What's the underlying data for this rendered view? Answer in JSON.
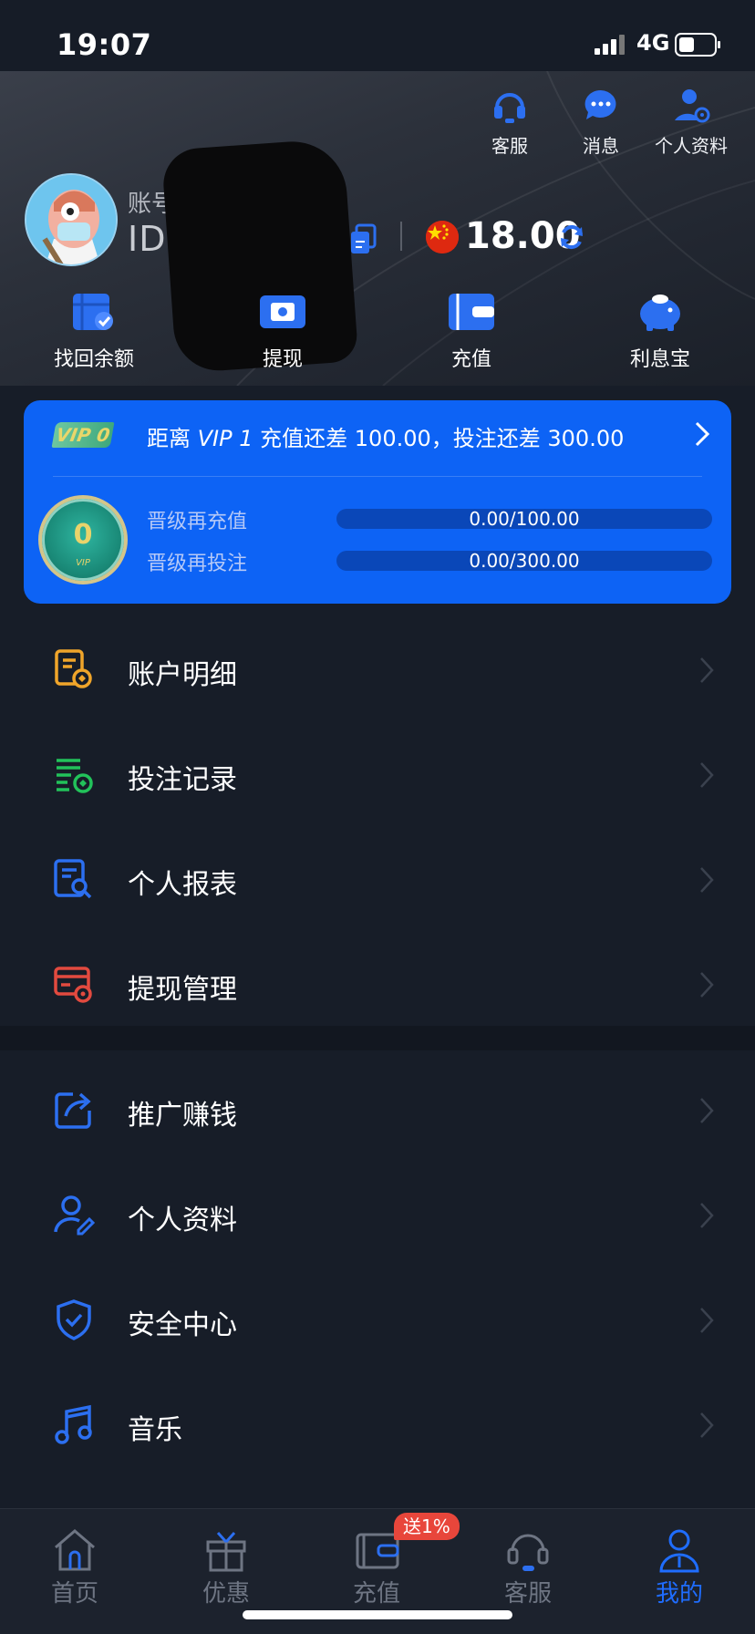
{
  "status_bar": {
    "time": "19:07",
    "network": "4G"
  },
  "header": {
    "top_links": [
      {
        "label": "客服",
        "icon": "headset-icon"
      },
      {
        "label": "消息",
        "icon": "chat-bubble-icon"
      },
      {
        "label": "个人资料",
        "icon": "user-settings-icon"
      }
    ],
    "account_label": "账号",
    "account_id_prefix": "ID",
    "balance": "18.00",
    "currency_flag": "cn-flag-icon",
    "quick_actions": [
      {
        "label": "找回余额",
        "icon": "recover-balance-icon"
      },
      {
        "label": "提现",
        "icon": "withdraw-icon"
      },
      {
        "label": "充值",
        "icon": "wallet-icon"
      },
      {
        "label": "利息宝",
        "icon": "piggy-bank-icon"
      }
    ]
  },
  "vip": {
    "badge": "VIP 0",
    "message_prefix": "距离",
    "message_level": "VIP 1",
    "message_suffix": "充值还差 100.00，投注还差 300.00",
    "medal_level": "0",
    "medal_text": "VIP",
    "rows": [
      {
        "label": "晋级再充值",
        "progress_text": "0.00/100.00",
        "progress": 0
      },
      {
        "label": "晋级再投注",
        "progress_text": "0.00/300.00",
        "progress": 0
      }
    ]
  },
  "menu_group_1": [
    {
      "label": "账户明细",
      "icon": "account-detail-icon",
      "color": "#f0a52a"
    },
    {
      "label": "投注记录",
      "icon": "bet-record-icon",
      "color": "#22c25a"
    },
    {
      "label": "个人报表",
      "icon": "report-icon",
      "color": "#2c6ff0"
    },
    {
      "label": "提现管理",
      "icon": "withdraw-manage-icon",
      "color": "#e24a3f"
    }
  ],
  "menu_group_2": [
    {
      "label": "推广赚钱",
      "icon": "share-icon",
      "color": "#2c6ff0"
    },
    {
      "label": "个人资料",
      "icon": "user-edit-icon",
      "color": "#2c6ff0"
    },
    {
      "label": "安全中心",
      "icon": "shield-icon",
      "color": "#2c6ff0"
    },
    {
      "label": "音乐",
      "icon": "music-icon",
      "color": "#2c6ff0"
    }
  ],
  "tabbar": {
    "tabs": [
      {
        "label": "首页",
        "icon": "home-icon"
      },
      {
        "label": "优惠",
        "icon": "gift-icon"
      },
      {
        "label": "充值",
        "icon": "wallet-icon"
      },
      {
        "label": "客服",
        "icon": "headset-icon"
      },
      {
        "label": "我的",
        "icon": "profile-icon",
        "active": true
      }
    ],
    "promo_badge": "送1%"
  },
  "colors": {
    "accent": "#0d63f5",
    "active_tab": "#1f6dff",
    "background": "#171d28"
  }
}
